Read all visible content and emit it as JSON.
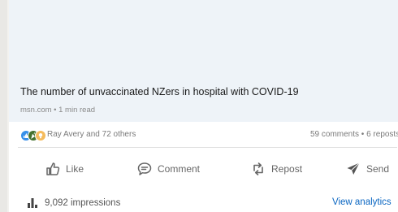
{
  "post": {
    "headline": "The number of unvaccinated NZers in hospital with COVID-19",
    "meta": "msn.com • 1 min read"
  },
  "social": {
    "reactions": [
      "like-reaction",
      "celebrate-reaction",
      "insightful-reaction"
    ],
    "names": "Ray Avery and 72 others",
    "counts": "59 comments • 6 reposts"
  },
  "actions": {
    "like": "Like",
    "comment": "Comment",
    "repost": "Repost",
    "send": "Send"
  },
  "analytics": {
    "impressions": "9,092 impressions",
    "view_link": "View analytics"
  },
  "colors": {
    "accent": "#0a66c2",
    "like_reaction": "#378fe9",
    "celebrate_reaction": "#44712e",
    "insight_reaction": "#f5bb5c"
  }
}
